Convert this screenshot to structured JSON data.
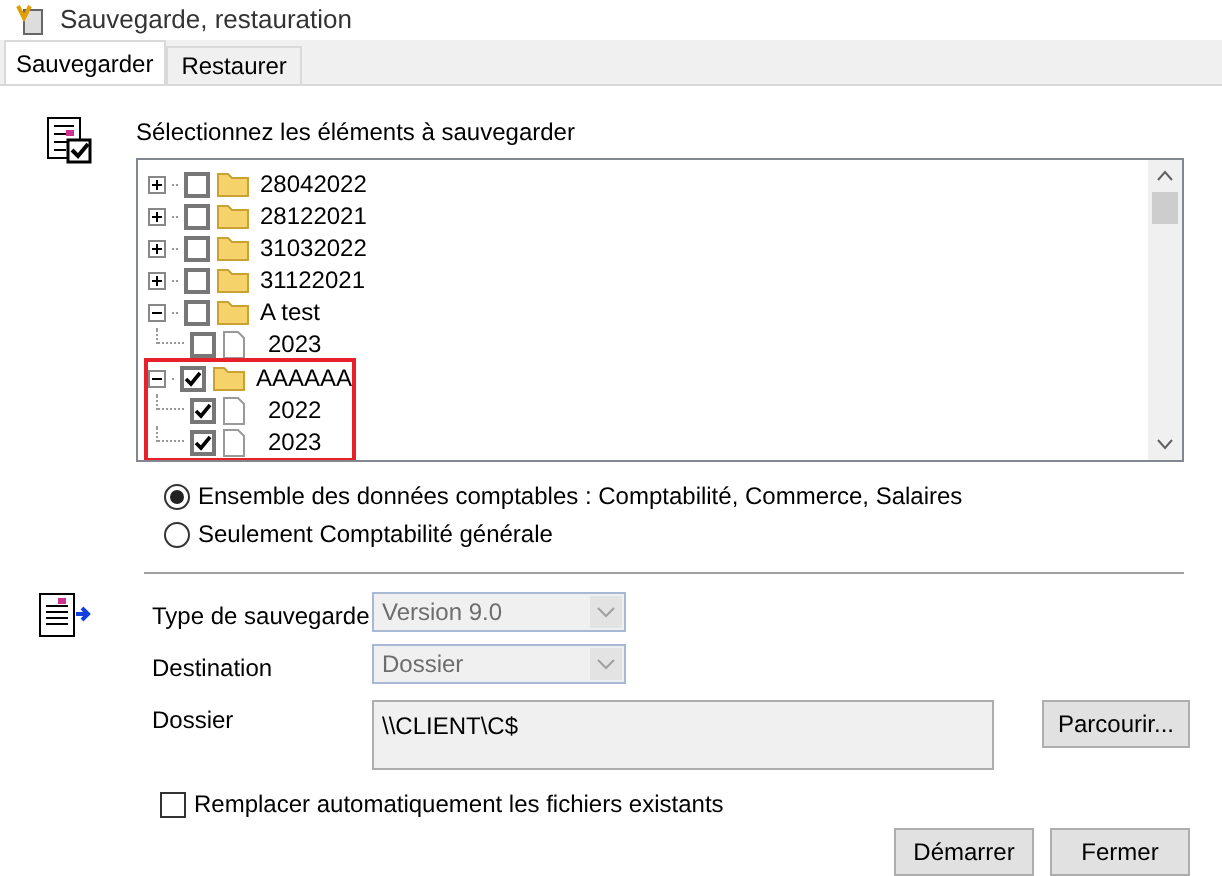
{
  "window": {
    "title": "Sauvegarde, restauration"
  },
  "tabs": [
    {
      "label": "Sauvegarder",
      "selected": true
    },
    {
      "label": "Restaurer",
      "selected": false
    }
  ],
  "tree": {
    "label": "Sélectionnez les éléments à sauvegarder",
    "items": [
      {
        "kind": "folder",
        "label": "28042022",
        "checked": false,
        "expanded": false
      },
      {
        "kind": "folder",
        "label": "28122021",
        "checked": false,
        "expanded": false
      },
      {
        "kind": "folder",
        "label": "31032022",
        "checked": false,
        "expanded": false
      },
      {
        "kind": "folder",
        "label": "31122021",
        "checked": false,
        "expanded": false
      },
      {
        "kind": "folder",
        "label": "A test",
        "checked": false,
        "expanded": true,
        "children": [
          {
            "kind": "file",
            "label": "2023",
            "checked": false
          }
        ]
      },
      {
        "kind": "folder",
        "label": "AAAAAA",
        "checked": true,
        "expanded": true,
        "highlighted": true,
        "children": [
          {
            "kind": "file",
            "label": "2022",
            "checked": true
          },
          {
            "kind": "file",
            "label": "2023",
            "checked": true
          }
        ]
      }
    ]
  },
  "scope": [
    {
      "label": "Ensemble des données comptables : Comptabilité, Commerce, Salaires",
      "selected": true
    },
    {
      "label": "Seulement Comptabilité générale",
      "selected": false
    }
  ],
  "form": {
    "type_label": "Type de sauvegarde",
    "type_value": "Version 9.0",
    "destination_label": "Destination",
    "destination_value": "Dossier",
    "folder_label": "Dossier",
    "folder_value": "\\\\CLIENT\\C$",
    "browse": "Parcourir..."
  },
  "replace": {
    "label": "Remplacer automatiquement les fichiers existants",
    "checked": false
  },
  "buttons": [
    "Démarrer",
    "Fermer"
  ]
}
